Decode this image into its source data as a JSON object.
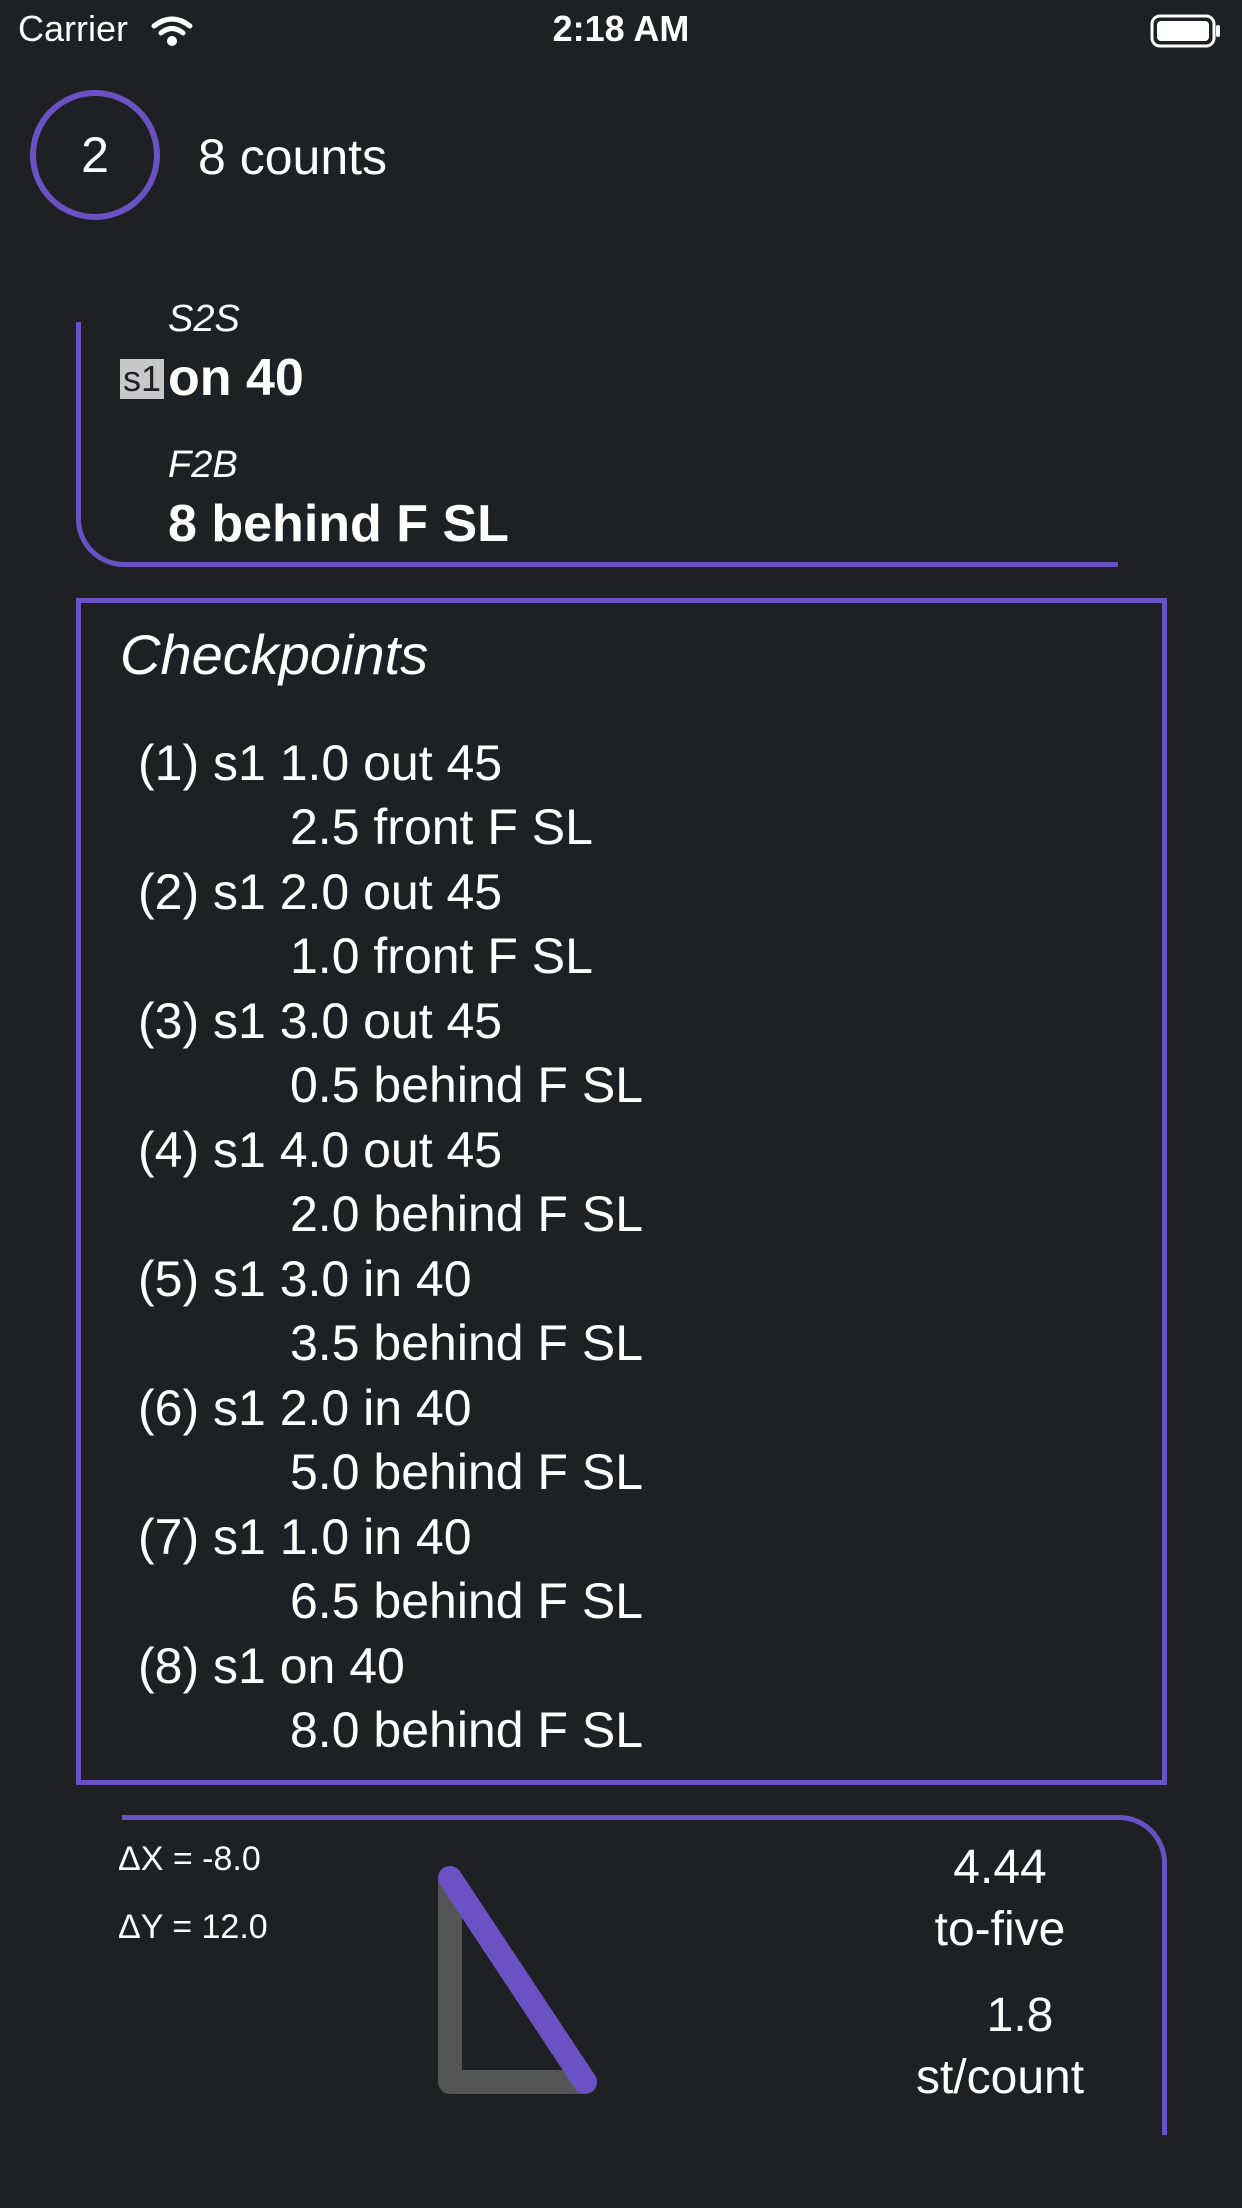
{
  "status_bar": {
    "carrier": "Carrier",
    "time": "2:18 AM",
    "wifi_icon": "wifi-icon",
    "battery_icon": "battery-full-icon"
  },
  "header": {
    "set_number": "2",
    "counts": "8 counts"
  },
  "position": {
    "s2s_caption": "S2S",
    "side_tag": "s1",
    "s2s_value": "on 40",
    "f2b_caption": "F2B",
    "f2b_value": "8 behind F SL"
  },
  "checkpoints": {
    "title": "Checkpoints",
    "items": [
      {
        "line1": "(1) s1 1.0 out 45",
        "line2": "2.5 front F SL"
      },
      {
        "line1": "(2) s1 2.0 out 45",
        "line2": "1.0 front F SL"
      },
      {
        "line1": "(3) s1 3.0 out 45",
        "line2": "0.5 behind F SL"
      },
      {
        "line1": "(4) s1 4.0 out 45",
        "line2": "2.0 behind F SL"
      },
      {
        "line1": "(5) s1 3.0 in 40",
        "line2": "3.5 behind F SL"
      },
      {
        "line1": "(6) s1 2.0 in 40",
        "line2": "5.0 behind F SL"
      },
      {
        "line1": "(7) s1 1.0 in 40",
        "line2": "6.5 behind F SL"
      },
      {
        "line1": "(8) s1 on 40",
        "line2": "8.0 behind F SL"
      }
    ]
  },
  "metrics": {
    "delta_x": "ΔX = -8.0",
    "delta_y": "ΔY = 12.0",
    "to_five_value": "4.44",
    "to_five_label": "to-five",
    "steps_per_count_value": "1.8",
    "steps_per_count_label": "st/count"
  },
  "colors": {
    "background": "#1f2024",
    "accent": "#6a52c4",
    "triangle_legs": "#555555",
    "tag_background": "#c8c8c8"
  }
}
